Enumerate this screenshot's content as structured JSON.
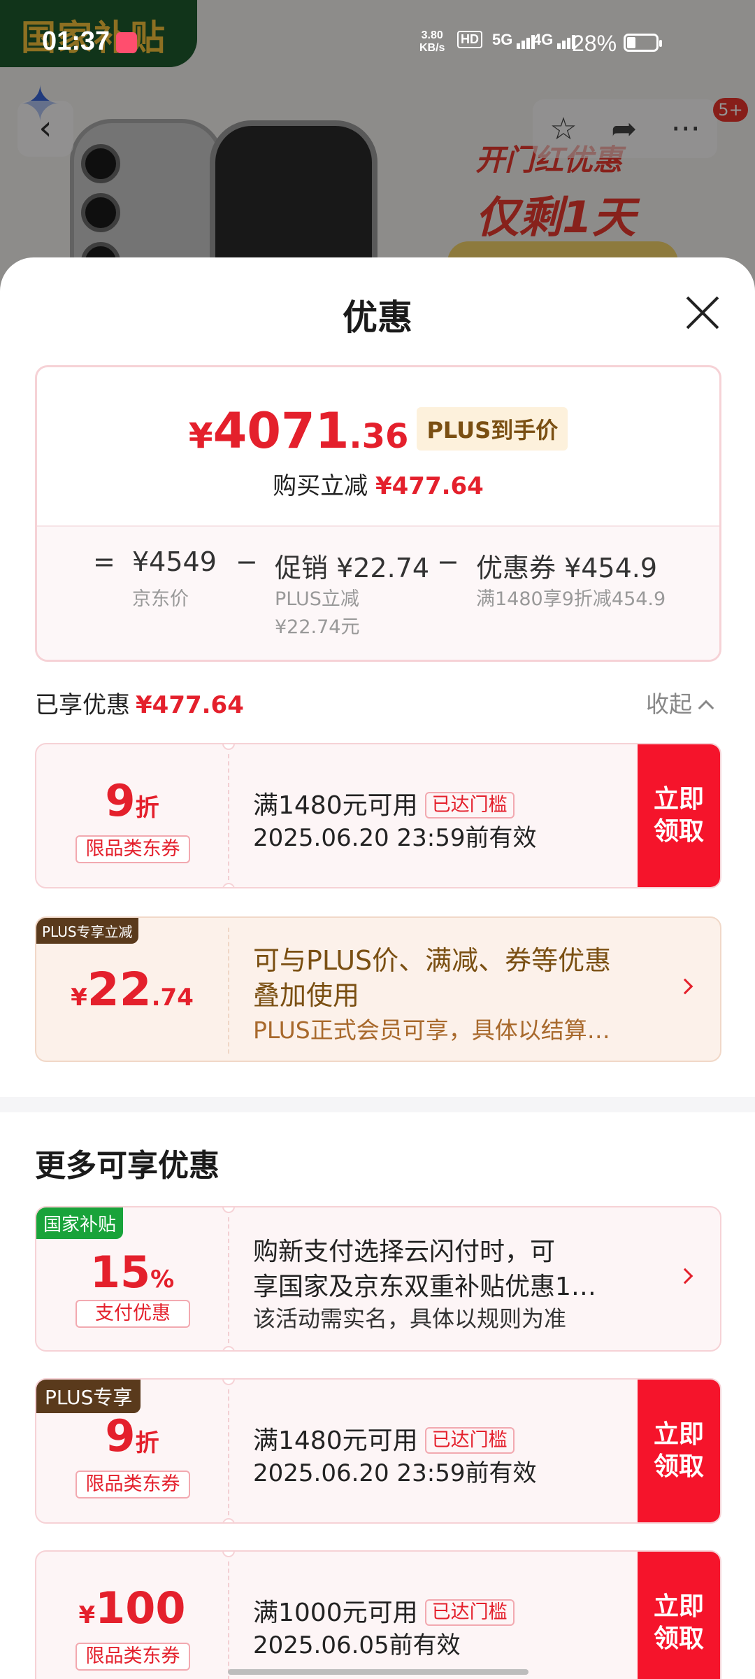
{
  "status_bar": {
    "time": "01:37",
    "net_speed_value": "3.80",
    "net_speed_unit": "KB/s",
    "hd_label": "HD",
    "sim1": "5G",
    "sim2": "4G",
    "battery": "28%"
  },
  "background": {
    "badge": "国家补贴",
    "promo_line1": "开门红优惠",
    "promo_line2": "仅剩1天",
    "more_badge": "5+"
  },
  "sheet": {
    "title": "优惠",
    "price": {
      "currency": "¥",
      "integer": "4071",
      "decimal": ".36",
      "tag": "PLUS到手价",
      "sub_label": "购买立减",
      "sub_value": "¥477.64"
    },
    "formula": {
      "eq": "=",
      "jd_price": "¥4549",
      "jd_price_label": "京东价",
      "minus1": "−",
      "promo": "促销 ¥22.74",
      "promo_sub1": "PLUS立减",
      "promo_sub2": "¥22.74元",
      "minus2": "−",
      "coupon": "优惠券 ¥454.9",
      "coupon_sub": "满1480享9折减454.9"
    },
    "enjoyed_label": "已享优惠",
    "enjoyed_value": "¥477.64",
    "collapse_label": "收起"
  },
  "enjoyed_coupons": [
    {
      "value": "9",
      "unit": "折",
      "chip": "限品类东券",
      "condition": "满1480元可用",
      "reached": "已达门槛",
      "valid": "2025.06.20 23:59前有效",
      "action": "立即领取"
    }
  ],
  "plus_discount": {
    "corner": "PLUS专享立减",
    "currency": "¥",
    "integer": "22",
    "decimal": ".74",
    "line1": "可与PLUS价、满减、券等优惠",
    "line2": "叠加使用",
    "line3": "PLUS正式会员可享，具体以结算…"
  },
  "more_title": "更多可享优惠",
  "more_offers": [
    {
      "corner": "国家补贴",
      "value": "15",
      "unit": "%",
      "chip": "支付优惠",
      "line1": "购新支付选择云闪付时，可",
      "line2": "享国家及京东双重补贴优惠1…",
      "line3": "该活动需实名，具体以规则为准"
    },
    {
      "corner": "PLUS专享",
      "value": "9",
      "unit": "折",
      "chip": "限品类东券",
      "condition": "满1480元可用",
      "reached": "已达门槛",
      "valid": "2025.06.20 23:59前有效",
      "action": "立即领取"
    },
    {
      "currency": "¥",
      "value": "100",
      "chip": "限品类东券",
      "condition": "满1000元可用",
      "reached": "已达门槛",
      "valid": "2025.06.05前有效",
      "action": "立即领取"
    }
  ],
  "colors": {
    "accent_red": "#e4202c",
    "button_red": "#f5142b",
    "plus_gold": "#7a4f12",
    "subsidy_green": "#19a33a"
  }
}
